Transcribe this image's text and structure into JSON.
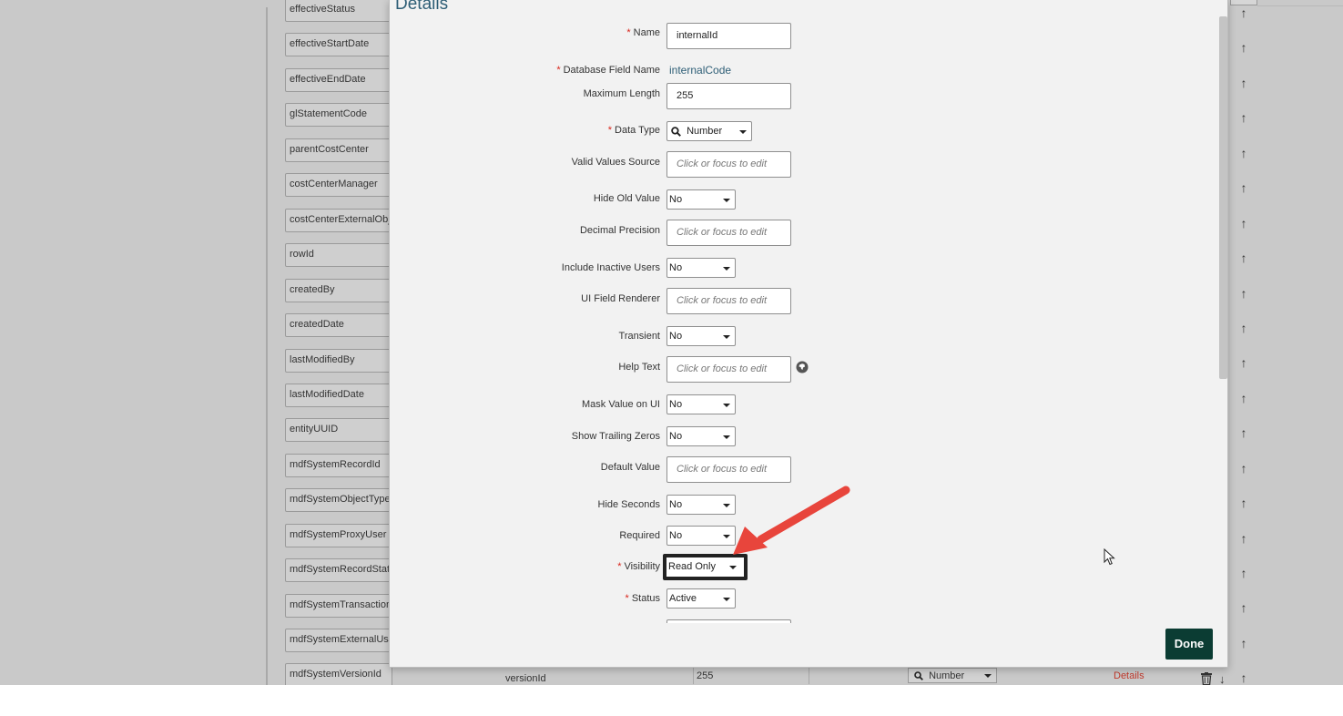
{
  "background": {
    "fields": [
      "effectiveStatus",
      "effectiveStartDate",
      "effectiveEndDate",
      "glStatementCode",
      "parentCostCenter",
      "costCenterManager",
      "costCenterExternalObj",
      "rowId",
      "createdBy",
      "createdDate",
      "lastModifiedBy",
      "lastModifiedDate",
      "entityUUID",
      "mdfSystemRecordId",
      "mdfSystemObjectType",
      "mdfSystemProxyUser",
      "mdfSystemRecordStat",
      "mdfSystemTransaction",
      "mdfSystemExternalUs",
      "mdfSystemVersionId"
    ],
    "bottom_row": {
      "name": "versionId",
      "max_length": "255",
      "data_type": "Number",
      "details_link": "Details"
    },
    "arrow_glyph": "↑",
    "down_glyph": "↓"
  },
  "dialog": {
    "title": "Details",
    "done_label": "Done",
    "fields": {
      "name": {
        "label": "Name",
        "required": "*",
        "value": "internalId"
      },
      "db_field_name": {
        "label": "Database Field Name",
        "required": "*",
        "value": "internalCode"
      },
      "max_length": {
        "label": "Maximum Length",
        "value": "255"
      },
      "data_type": {
        "label": "Data Type",
        "required": "*",
        "value": "Number"
      },
      "valid_values_source": {
        "label": "Valid Values Source",
        "placeholder": "Click or focus to edit"
      },
      "hide_old_value": {
        "label": "Hide Old Value",
        "value": "No"
      },
      "decimal_precision": {
        "label": "Decimal Precision",
        "placeholder": "Click or focus to edit"
      },
      "include_inactive_users": {
        "label": "Include Inactive Users",
        "value": "No"
      },
      "ui_field_renderer": {
        "label": "UI Field Renderer",
        "placeholder": "Click or focus to edit"
      },
      "transient": {
        "label": "Transient",
        "value": "No"
      },
      "help_text": {
        "label": "Help Text",
        "placeholder": "Click or focus to edit"
      },
      "mask_value_on_ui": {
        "label": "Mask Value on UI",
        "value": "No"
      },
      "show_trailing_zeros": {
        "label": "Show Trailing Zeros",
        "value": "No"
      },
      "default_value": {
        "label": "Default Value",
        "placeholder": "Click or focus to edit"
      },
      "hide_seconds": {
        "label": "Hide Seconds",
        "value": "No"
      },
      "required_field": {
        "label": "Required",
        "value": "No"
      },
      "visibility": {
        "label": "Visibility",
        "required": "*",
        "value": "Read Only"
      },
      "status": {
        "label": "Status",
        "required": "*",
        "value": "Active"
      }
    }
  },
  "colors": {
    "title": "#2e5e76",
    "required_star": "#d9261c",
    "done_button": "#0b3c33",
    "annotation_arrow": "#e8453c",
    "details_link": "#c0392b"
  },
  "icons": {
    "search": "search-icon",
    "help": "globe-help-icon",
    "caret": "caret-down-icon",
    "sort_up": "arrow-up-icon",
    "sort_down": "arrow-down-icon",
    "delete": "trash-icon",
    "cursor": "mouse-pointer-icon",
    "annotation": "annotation-arrow-icon"
  }
}
